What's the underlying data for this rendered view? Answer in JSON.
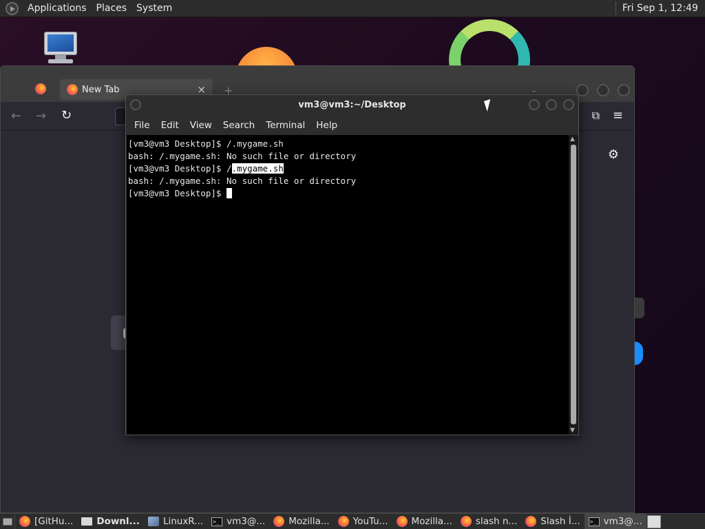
{
  "top_panel": {
    "menus": [
      "Applications",
      "Places",
      "System"
    ],
    "clock": "Fri Sep  1, 12:49"
  },
  "browser": {
    "tab_title": "New Tab",
    "tab_close": "×",
    "new_tab": "+",
    "tab_list": "⌄"
  },
  "terminal": {
    "title": "vm3@vm3:~/Desktop",
    "menus": [
      "File",
      "Edit",
      "View",
      "Search",
      "Terminal",
      "Help"
    ],
    "lines": [
      "[vm3@vm3 Desktop]$ /.mygame.sh",
      "bash: /.mygame.sh: No such file or directory",
      "[vm3@vm3 Desktop]$ /",
      "bash: /.mygame.sh: No such file or directory",
      "[vm3@vm3 Desktop]$ "
    ],
    "selected_text": ".mygame.sh"
  },
  "taskbar": {
    "items": [
      {
        "label": "[GitHu...",
        "icon": "firefox-icon"
      },
      {
        "label": "Downl...",
        "icon": "folder-icon"
      },
      {
        "label": "LinuxR...",
        "icon": "tool-icon"
      },
      {
        "label": "vm3@...",
        "icon": "terminal-icon"
      },
      {
        "label": "Mozilla...",
        "icon": "firefox-icon"
      },
      {
        "label": "YouTu...",
        "icon": "firefox-icon"
      },
      {
        "label": "Mozilla...",
        "icon": "firefox-icon"
      },
      {
        "label": "slash n...",
        "icon": "firefox-icon"
      },
      {
        "label": "Slash İ...",
        "icon": "firefox-icon"
      },
      {
        "label": "vm3@...",
        "icon": "terminal-icon"
      }
    ]
  }
}
